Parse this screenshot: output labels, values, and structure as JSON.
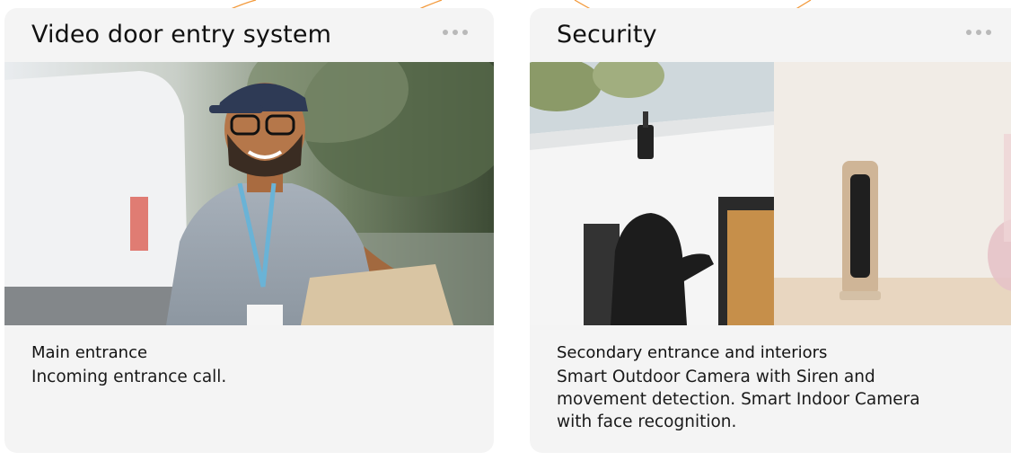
{
  "cards": [
    {
      "title": "Video door entry system",
      "more_icon": "more-horizontal-icon",
      "image": "delivery-man-photo",
      "subtitle": "Main entrance",
      "description": "Incoming entrance call."
    },
    {
      "title": "Security",
      "more_icon": "more-horizontal-icon",
      "image": "security-cameras-photo",
      "subtitle": "Secondary entrance and interiors",
      "description": "Smart Outdoor Camera with Siren and movement detection. Smart Indoor Camera with face recognition."
    }
  ],
  "colors": {
    "accent": "#f39a3c",
    "card_bg": "#f4f4f4",
    "dots": "#b9b9b9",
    "text": "#111111"
  }
}
